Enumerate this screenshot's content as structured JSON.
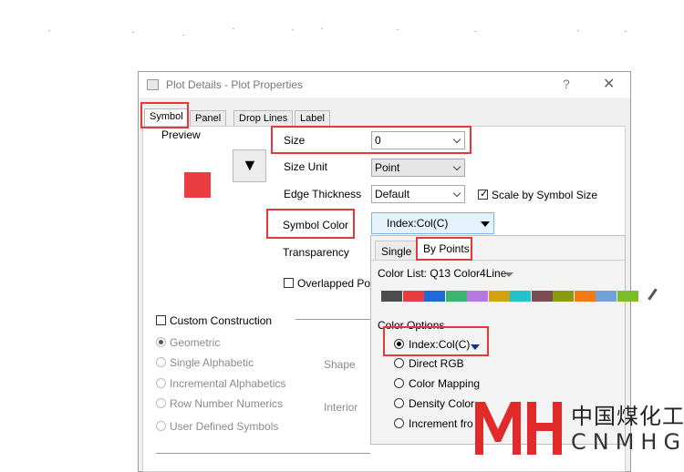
{
  "dialog": {
    "title": "Plot Details - Plot Properties",
    "help": "?",
    "close": "✕"
  },
  "tabs": [
    "Symbol",
    "Panel",
    "Drop Lines",
    "Label"
  ],
  "preview": {
    "label": "Preview",
    "symbol_color": "#ea3c41",
    "symbol_glyph": "▼"
  },
  "fields": {
    "size": {
      "label": "Size",
      "value": "0"
    },
    "size_unit": {
      "label": "Size Unit",
      "value": "Point"
    },
    "edge_thickness": {
      "label": "Edge Thickness",
      "value": "Default"
    },
    "scale_by_symbol_size": "Scale by Symbol Size",
    "symbol_color": {
      "label": "Symbol Color",
      "value": "Index:Col(C)"
    },
    "transparency": {
      "label": "Transparency"
    },
    "overlapped_points": "Overlapped Poi"
  },
  "construction": {
    "custom": "Custom Construction",
    "options": [
      "Geometric",
      "Single Alphabetic",
      "Incremental Alphabetics",
      "Row Number Numerics",
      "User Defined Symbols"
    ],
    "shape": "Shape",
    "interior": "Interior"
  },
  "popup": {
    "tabs": [
      "Single",
      "By Points"
    ],
    "color_list": "Color List: Q13 Color4Line",
    "palette": [
      "#4d4d4d",
      "#ea3c41",
      "#1f6bd6",
      "#3cb371",
      "#b779e0",
      "#d4a10f",
      "#22c4c9",
      "#7d4b52",
      "#8a9a11",
      "#f27a17",
      "#6fa3d8",
      "#7bbd28"
    ],
    "color_options": "Color Options",
    "options": [
      "Index:Col(C)",
      "Direct RGB",
      "Color Mapping",
      "Density Color",
      "Increment fro"
    ]
  },
  "watermark": {
    "cn": "中国煤化工",
    "en": "CNMHG"
  }
}
